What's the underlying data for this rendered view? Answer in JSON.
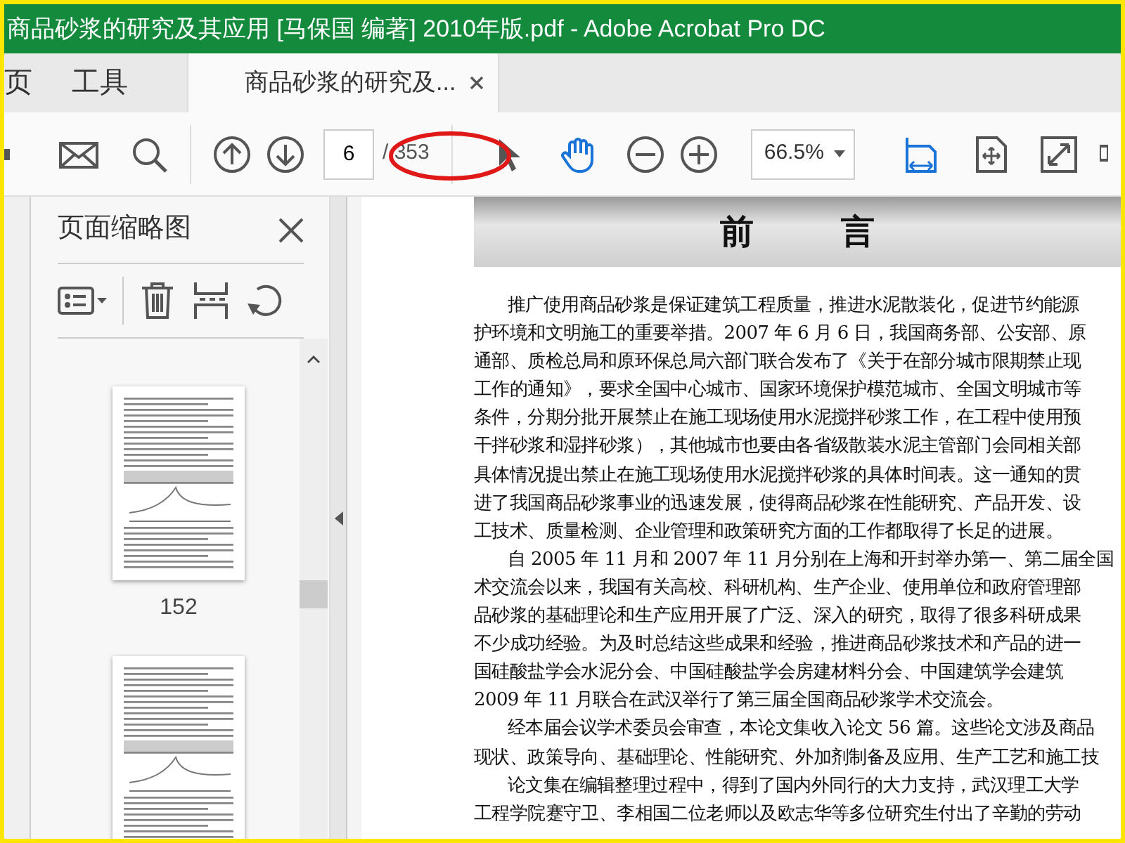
{
  "window": {
    "title": "商品砂浆的研究及其应用 [马保国 编著] 2010年版.pdf - Adobe Acrobat Pro DC"
  },
  "tabs": [
    {
      "label": "页",
      "selected": false
    },
    {
      "label": "工具",
      "selected": false
    },
    {
      "label": "商品砂浆的研究及...",
      "selected": true
    }
  ],
  "toolbar": {
    "page_number": "6",
    "page_count": "/ 353",
    "zoom": "66.5%"
  },
  "thumbnail_panel": {
    "title": "页面缩略图",
    "thumbnails": [
      {
        "label": "152",
        "selected": false
      },
      {
        "selected": false
      }
    ]
  },
  "document": {
    "heading": "前言",
    "lines": [
      {
        "text": "推广使用商品砂浆是保证建筑工程质量，推进水泥散装化，促进节约能源",
        "indent": true
      },
      {
        "text": "护环境和文明施工的重要举措。2007 年 6 月 6 日，我国商务部、公安部、原",
        "indent": false
      },
      {
        "text": "通部、质检总局和原环保总局六部门联合发布了《关于在部分城市限期禁止现",
        "indent": false
      },
      {
        "text": "工作的通知》，要求全国中心城市、国家环境保护模范城市、全国文明城市等",
        "indent": false
      },
      {
        "text": "条件，分期分批开展禁止在施工现场使用水泥搅拌砂浆工作，在工程中使用预",
        "indent": false
      },
      {
        "text": "干拌砂浆和湿拌砂浆），其他城市也要由各省级散装水泥主管部门会同相关部",
        "indent": false
      },
      {
        "text": "具体情况提出禁止在施工现场使用水泥搅拌砂浆的具体时间表。这一通知的贯",
        "indent": false
      },
      {
        "text": "进了我国商品砂浆事业的迅速发展，使得商品砂浆在性能研究、产品开发、设",
        "indent": false
      },
      {
        "text": "工技术、质量检测、企业管理和政策研究方面的工作都取得了长足的进展。",
        "indent": false
      },
      {
        "text": "自 2005 年 11 月和 2007 年 11 月分别在上海和开封举办第一、第二届全国",
        "indent": true
      },
      {
        "text": "术交流会以来，我国有关高校、科研机构、生产企业、使用单位和政府管理部",
        "indent": false
      },
      {
        "text": "品砂浆的基础理论和生产应用开展了广泛、深入的研究，取得了很多科研成果",
        "indent": false
      },
      {
        "text": "不少成功经验。为及时总结这些成果和经验，推进商品砂浆技术和产品的进一",
        "indent": false
      },
      {
        "text": "国硅酸盐学会水泥分会、中国硅酸盐学会房建材料分会、中国建筑学会建筑",
        "indent": false
      },
      {
        "text": "2009 年 11 月联合在武汉举行了第三届全国商品砂浆学术交流会。",
        "indent": false
      },
      {
        "text": "经本届会议学术委员会审查，本论文集收入论文 56 篇。这些论文涉及商品",
        "indent": true
      },
      {
        "text": "现状、政策导向、基础理论、性能研究、外加剂制备及应用、生产工艺和施工技",
        "indent": false
      },
      {
        "text": "论文集在编辑整理过程中，得到了国内外同行的大力支持，武汉理工大学",
        "indent": true
      },
      {
        "text": "工程学院蹇守卫、李相国二位老师以及欧志华等多位研究生付出了辛勤的劳动",
        "indent": false
      }
    ]
  }
}
